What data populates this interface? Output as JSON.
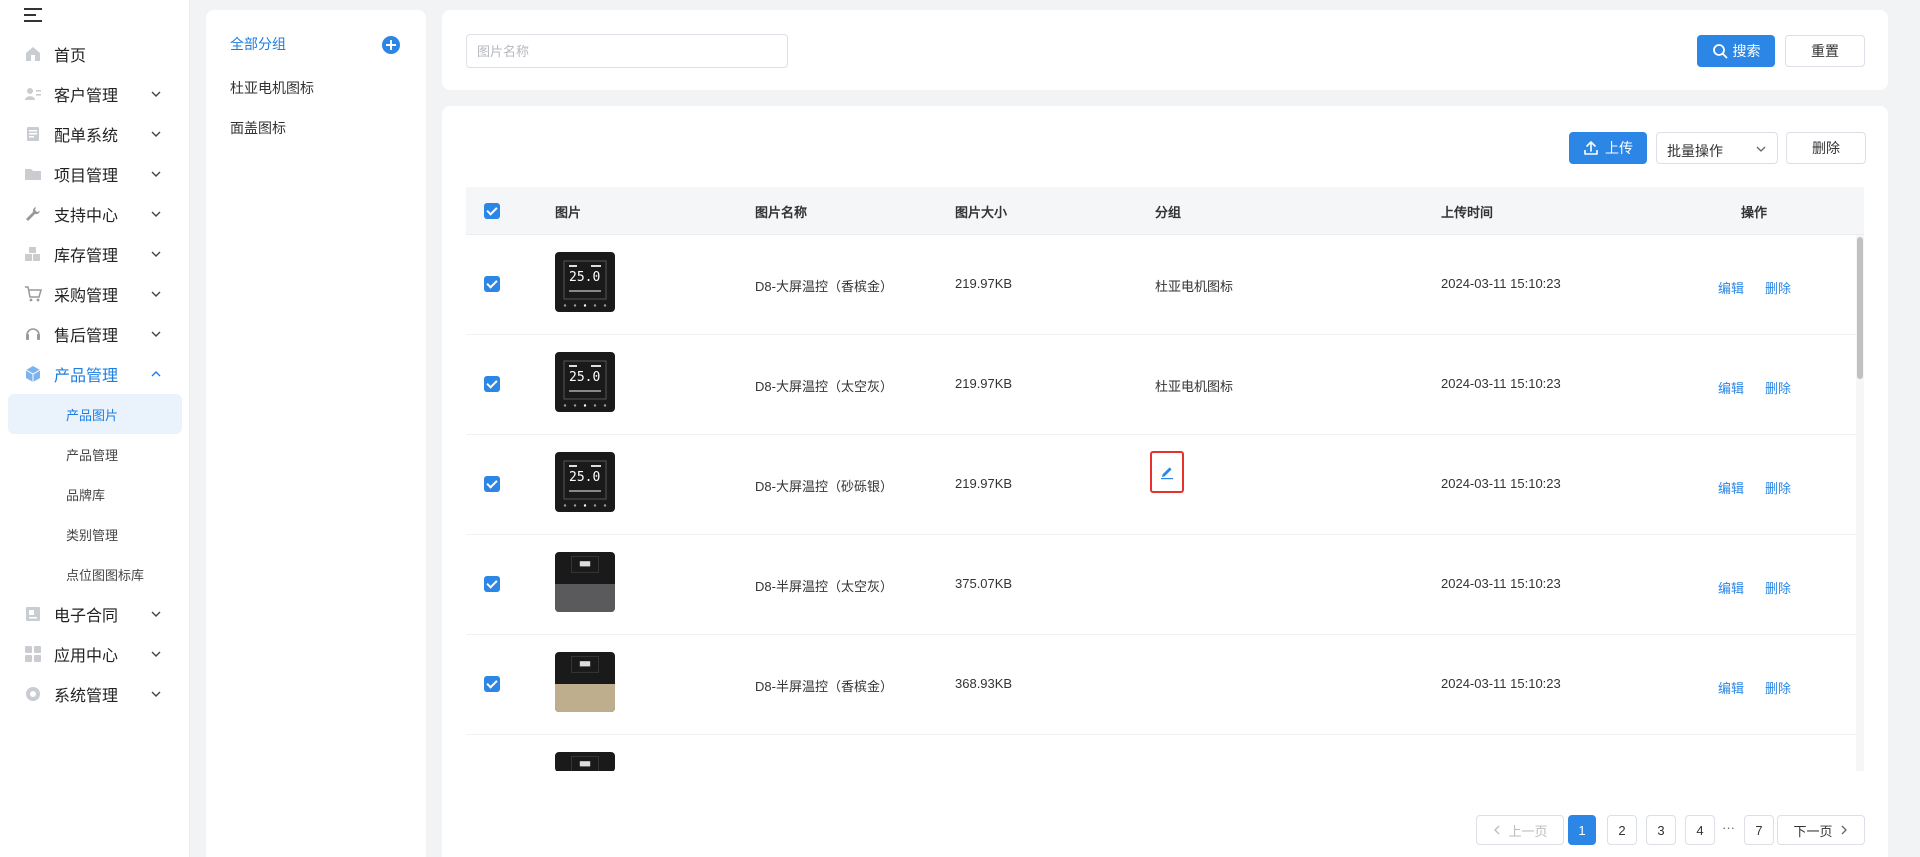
{
  "sidebar": {
    "items": [
      {
        "label": "首页",
        "icon": "home-icon",
        "expandable": false
      },
      {
        "label": "客户管理",
        "icon": "customer-icon",
        "expandable": true
      },
      {
        "label": "配单系统",
        "icon": "document-icon",
        "expandable": true
      },
      {
        "label": "项目管理",
        "icon": "folder-icon",
        "expandable": true
      },
      {
        "label": "支持中心",
        "icon": "wrench-icon",
        "expandable": true
      },
      {
        "label": "库存管理",
        "icon": "boxes-icon",
        "expandable": true
      },
      {
        "label": "采购管理",
        "icon": "cart-icon",
        "expandable": true
      },
      {
        "label": "售后管理",
        "icon": "headset-icon",
        "expandable": true
      },
      {
        "label": "产品管理",
        "icon": "cube-icon",
        "expandable": true,
        "expanded": true,
        "active": true
      },
      {
        "label": "电子合同",
        "icon": "contract-icon",
        "expandable": true
      },
      {
        "label": "应用中心",
        "icon": "grid-icon",
        "expandable": true
      },
      {
        "label": "系统管理",
        "icon": "settings-icon",
        "expandable": true
      }
    ],
    "sub_items": [
      "产品图片",
      "产品管理",
      "品牌库",
      "类别管理",
      "点位图图标库"
    ],
    "active_sub": "产品图片"
  },
  "groups": {
    "items": [
      "全部分组",
      "杜亚电机图标",
      "面盖图标"
    ],
    "active": "全部分组"
  },
  "search": {
    "placeholder": "图片名称",
    "value": "",
    "search_label": "搜索",
    "reset_label": "重置"
  },
  "toolbar": {
    "upload_label": "上传",
    "batch_label": "批量操作",
    "delete_label": "删除"
  },
  "table": {
    "columns": [
      "图片",
      "图片名称",
      "图片大小",
      "分组",
      "上传时间",
      "操作"
    ],
    "rows": [
      {
        "name": "D8-大屏温控（香槟金）",
        "size": "219.97KB",
        "group": "杜亚电机图标",
        "time": "2024-03-11 15:10:23",
        "thumb": "full",
        "checked": true
      },
      {
        "name": "D8-大屏温控（太空灰）",
        "size": "219.97KB",
        "group": "杜亚电机图标",
        "time": "2024-03-11 15:10:23",
        "thumb": "full",
        "checked": true
      },
      {
        "name": "D8-大屏温控（砂砾银）",
        "size": "219.97KB",
        "group": "",
        "time": "2024-03-11 15:10:23",
        "thumb": "full",
        "checked": true,
        "group_edit_highlight": true
      },
      {
        "name": "D8-半屏温控（太空灰）",
        "size": "375.07KB",
        "group": "",
        "time": "2024-03-11 15:10:23",
        "thumb": "half-gray",
        "checked": true
      },
      {
        "name": "D8-半屏温控（香槟金）",
        "size": "368.93KB",
        "group": "",
        "time": "2024-03-11 15:10:23",
        "thumb": "half-gold",
        "checked": true
      },
      {
        "name": "",
        "size": "",
        "group": "",
        "time": "",
        "thumb": "half-partial",
        "checked": false,
        "partial": true
      }
    ],
    "edit_label": "编辑",
    "delete_label": "删除",
    "display_value": "25.0"
  },
  "pagination": {
    "prev_label": "上一页",
    "next_label": "下一页",
    "pages": [
      "1",
      "2",
      "3",
      "4"
    ],
    "ellipsis": "···",
    "last_page": "7",
    "current": "1"
  },
  "colors": {
    "accent": "#2b86e6",
    "highlight_border": "#e6322b",
    "active_bg": "#eaf2fc"
  }
}
